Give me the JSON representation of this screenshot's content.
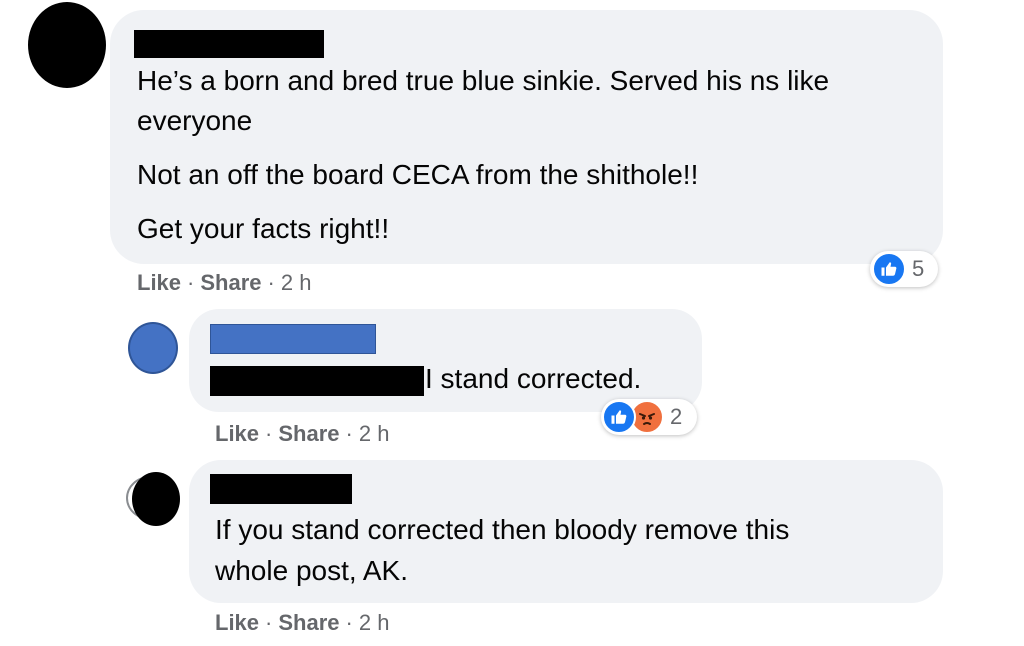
{
  "comments": [
    {
      "avatar_color": "#000000",
      "name_redaction_color": "#000000",
      "lines": [
        "He’s a born and bred true blue sinkie. Served his ns like",
        "everyone",
        "Not an off the board CECA from the shithole!!",
        "Get your facts right!!"
      ],
      "actions": {
        "like": "Like",
        "share": "Share",
        "separator": "·",
        "time": "2 h"
      },
      "reactions": {
        "icons": [
          "like-icon"
        ],
        "count": "5"
      }
    },
    {
      "avatar_color": "#4472c4",
      "name_redaction_color": "#4472c4",
      "text": "I stand corrected.",
      "actions": {
        "like": "Like",
        "share": "Share",
        "separator": "·",
        "time": "2 h"
      },
      "reactions": {
        "icons": [
          "like-icon",
          "angry-icon"
        ],
        "count": "2"
      }
    },
    {
      "avatar_color": "#000000",
      "name_redaction_color": "#000000",
      "lines": [
        "If you stand corrected then bloody remove this",
        "whole post, AK."
      ],
      "actions": {
        "like": "Like",
        "share": "Share",
        "separator": "·",
        "time": "2 h"
      }
    }
  ],
  "colors": {
    "bubble": "#f0f2f5",
    "like_blue": "#1877f2",
    "angry_orange": "#f0703e",
    "meta_gray": "#65676b"
  }
}
